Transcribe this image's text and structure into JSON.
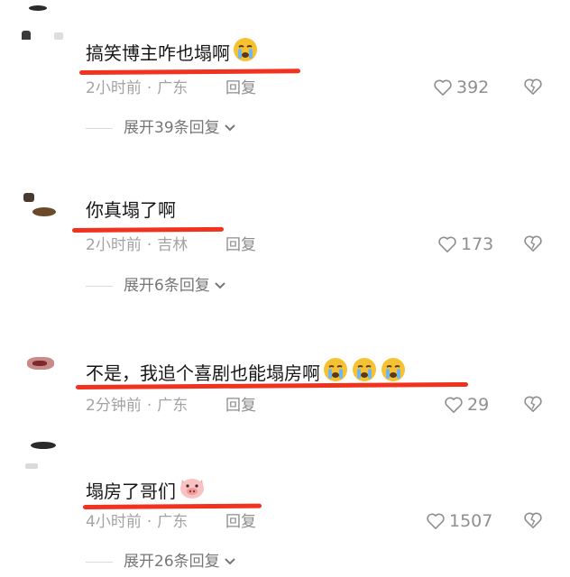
{
  "comments": [
    {
      "text": "搞笑博主咋也塌啊",
      "emoji": "crying-face-icon",
      "emoji_count": 1,
      "time": "2小时前",
      "location": "广东",
      "reply_label": "回复",
      "likes": "392",
      "expand_label": "展开39条回复"
    },
    {
      "text": "你真塌了啊",
      "emoji": "",
      "emoji_count": 0,
      "time": "2小时前",
      "location": "吉林",
      "reply_label": "回复",
      "likes": "173",
      "expand_label": "展开6条回复"
    },
    {
      "text": "不是，我追个喜剧也能塌房啊",
      "emoji": "crying-face-icon",
      "emoji_count": 3,
      "time": "2分钟前",
      "location": "广东",
      "reply_label": "回复",
      "likes": "29",
      "expand_label": ""
    },
    {
      "text": "塌房了哥们",
      "emoji": "pig-face-icon",
      "emoji_count": 1,
      "time": "4小时前",
      "location": "广东",
      "reply_label": "回复",
      "likes": "1507",
      "expand_label": "展开26条回复"
    }
  ],
  "meta_separator": "·",
  "colors": {
    "underline": "#f0321e",
    "text": "#161616",
    "meta": "#a3a3a3",
    "icon": "#8f8f8f"
  }
}
